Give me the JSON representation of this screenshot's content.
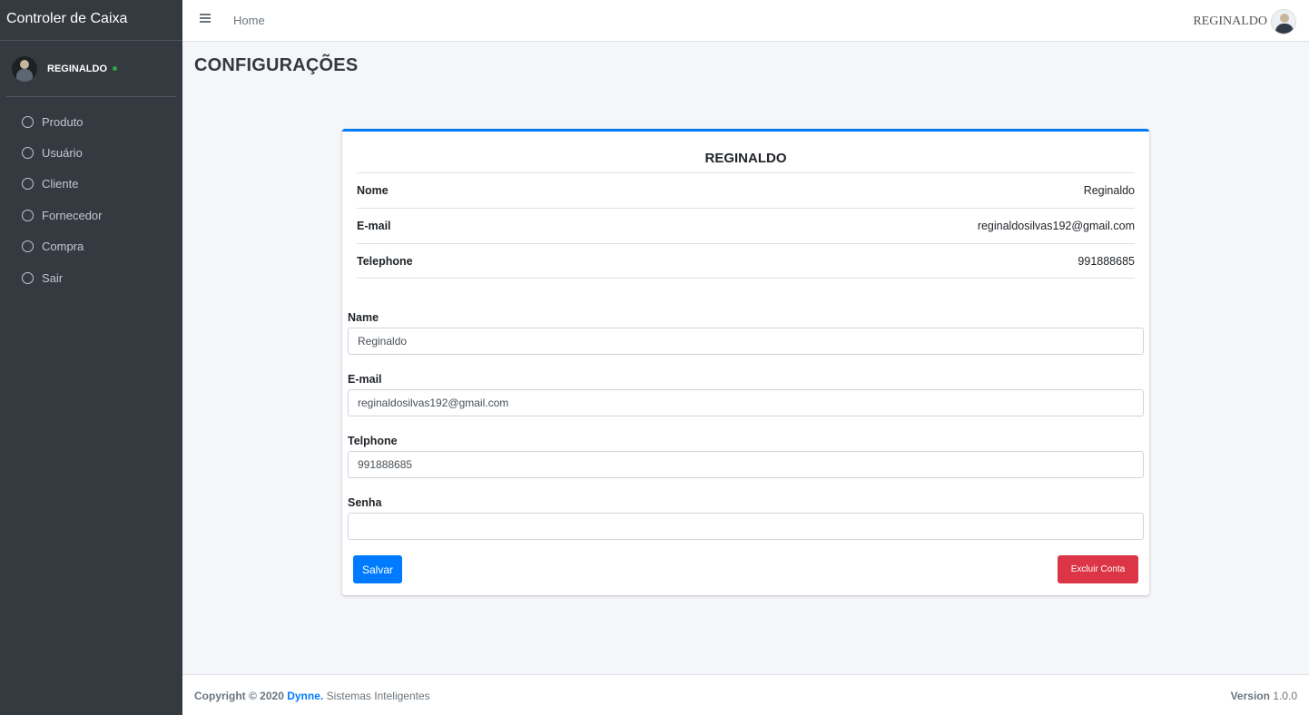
{
  "app": {
    "brand": "Controler de Caixa"
  },
  "user": {
    "name": "REGINALDO",
    "status_color": "#28a745"
  },
  "sidebar": {
    "items": [
      {
        "label": "Produto",
        "icon": "circle-outline-icon"
      },
      {
        "label": "Usuário",
        "icon": "circle-outline-icon"
      },
      {
        "label": "Cliente",
        "icon": "circle-outline-icon"
      },
      {
        "label": "Fornecedor",
        "icon": "circle-outline-icon"
      },
      {
        "label": "Compra",
        "icon": "circle-outline-icon"
      },
      {
        "label": "Sair",
        "icon": "circle-outline-icon"
      }
    ]
  },
  "topbar": {
    "menu_icon": "hamburger-icon",
    "home_label": "Home",
    "user_name": "REGINALDO"
  },
  "page": {
    "title": "CONFIGURAÇÕES"
  },
  "profile_card": {
    "title": "REGINALDO",
    "accent_color": "#007bff",
    "rows": [
      {
        "label": "Nome",
        "value": "Reginaldo"
      },
      {
        "label": "E-mail",
        "value": "reginaldosilvas192@gmail.com"
      },
      {
        "label": "Telephone",
        "value": "991888685"
      }
    ]
  },
  "form": {
    "name": {
      "label": "Name",
      "value": "Reginaldo"
    },
    "email": {
      "label": "E-mail",
      "value": "reginaldosilvas192@gmail.com"
    },
    "phone": {
      "label": "Telphone",
      "value": "991888685"
    },
    "password": {
      "label": "Senha",
      "value": ""
    },
    "save_label": "Salvar",
    "delete_label": "Excluir Conta",
    "save_color": "#007bff",
    "delete_color": "#dc3545"
  },
  "footer": {
    "copyright": "Copyright © 2020",
    "company": "Dynne.",
    "tagline": "Sistemas Inteligentes",
    "version_label": "Version",
    "version_value": "1.0.0"
  }
}
